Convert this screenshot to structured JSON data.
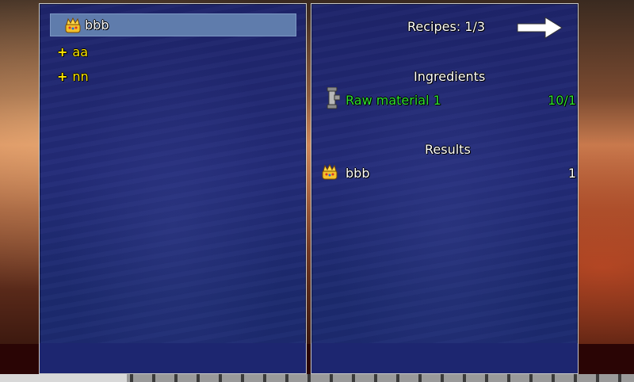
{
  "recipe_list": {
    "items": [
      {
        "label": "bbb",
        "icon": "crown-icon",
        "selected": true
      },
      {
        "label": "aa",
        "prefix": "+",
        "selected": false
      },
      {
        "label": "nn",
        "prefix": "+",
        "selected": false
      }
    ]
  },
  "detail": {
    "recipes_label": "Recipes: 1/3",
    "next_icon": "right-arrow-icon",
    "ingredients_title": "Ingredients",
    "ingredients": [
      {
        "icon": "pipe-icon",
        "name": "Raw material 1",
        "count": "10/1"
      }
    ],
    "results_title": "Results",
    "results": [
      {
        "icon": "crown-icon",
        "name": "bbb",
        "count": "1"
      }
    ]
  },
  "colors": {
    "panel": "#1e246a",
    "selected_row": "#5f7cac",
    "accent_yellow": "#ffe800",
    "ingredient_green": "#2fe030"
  }
}
